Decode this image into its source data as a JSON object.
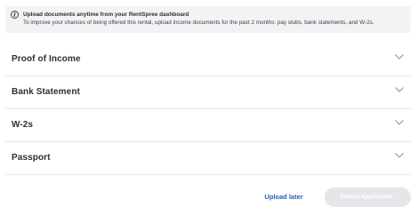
{
  "banner": {
    "icon": "info-icon",
    "title": "Upload documents anytime from your RentSpree dashboard",
    "text": "To improve your chances of being offered this rental, upload income documents for the past 2 months: pay stubs, bank statements, and W-2s."
  },
  "sections": [
    {
      "label": "Proof of Income",
      "icon": "chevron-down-icon"
    },
    {
      "label": "Bank Statement",
      "icon": "chevron-down-icon"
    },
    {
      "label": "W-2s",
      "icon": "chevron-down-icon"
    },
    {
      "label": "Passport",
      "icon": "chevron-down-icon"
    }
  ],
  "actions": {
    "upload_later_label": "Upload later",
    "submit_label": "Submit Application",
    "submit_icon": "chevron-right-icon"
  },
  "colors": {
    "link": "#2a5db0",
    "disabled_button": "#e4e6ea",
    "banner_bg": "#f2f3f5",
    "divider": "#e6e7ea"
  }
}
